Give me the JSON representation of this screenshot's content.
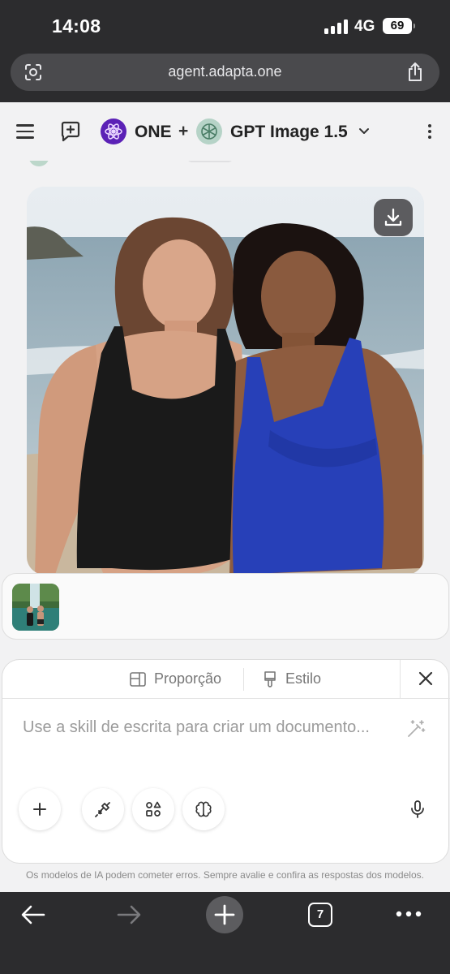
{
  "status_bar": {
    "time": "14:08",
    "network": "4G",
    "battery": "69"
  },
  "browser": {
    "url": "agent.adapta.one",
    "tab_count": "7"
  },
  "header": {
    "assistant_name": "ONE",
    "separator": "+",
    "model_name": "GPT Image 1.5"
  },
  "generated_image": {
    "subject": "two smiling women in swimsuits on a beach",
    "left_swimsuit_color": "#1a1a1a",
    "right_swimsuit_color": "#2740b8"
  },
  "composer": {
    "option_aspect": "Proporção",
    "option_style": "Estilo",
    "placeholder": "Use a skill de escrita para criar um documento..."
  },
  "disclaimer": "Os modelos de IA podem cometer erros. Sempre avalie e confira as respostas dos modelos.",
  "colors": {
    "one_logo": "#5b21b6",
    "gpt_logo": "#b6d3c7",
    "chrome_dark": "#2c2c2e"
  }
}
